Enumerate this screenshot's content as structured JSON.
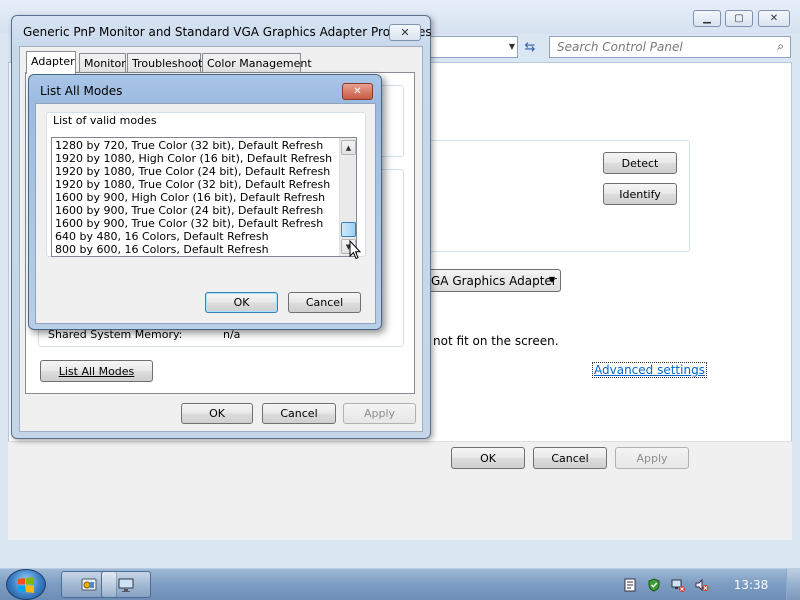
{
  "control_panel": {
    "search_placeholder": "Search Control Panel",
    "detect_label": "Detect",
    "identify_label": "Identify",
    "display_select": "GA Graphics Adapter",
    "fit_text": "not fit on the screen.",
    "advanced_link": "Advanced settings",
    "ok_label": "OK",
    "cancel_label": "Cancel",
    "apply_label": "Apply",
    "minimize_icon": "minimize-icon",
    "maximize_icon": "maximize-icon",
    "close_icon": "close-icon"
  },
  "properties_dialog": {
    "title": "Generic PnP Monitor and Standard VGA Graphics Adapter Properties",
    "close_glyph": "✕",
    "tabs": [
      "Adapter",
      "Monitor",
      "Troubleshoot",
      "Color Management"
    ],
    "active_tab": "Adapter",
    "shared_memory_label": "Shared System Memory:",
    "shared_memory_value": "n/a",
    "list_all_modes_label": "List All Modes",
    "ok_label": "OK",
    "cancel_label": "Cancel",
    "apply_label": "Apply"
  },
  "list_all_modes_dialog": {
    "title": "List All Modes",
    "group_label": "List of valid modes",
    "modes": [
      "1280 by 720, True Color (32 bit), Default Refresh",
      "1920 by 1080, High Color (16 bit), Default Refresh",
      "1920 by 1080, True Color (24 bit), Default Refresh",
      "1920 by 1080, True Color (32 bit), Default Refresh",
      "1600 by 900, High Color (16 bit), Default Refresh",
      "1600 by 900, True Color (24 bit), Default Refresh",
      "1600 by 900, True Color (32 bit), Default Refresh",
      "640 by 480, 16 Colors, Default Refresh",
      "800 by 600, 16 Colors, Default Refresh"
    ],
    "ok_label": "OK",
    "cancel_label": "Cancel"
  },
  "taskbar": {
    "clock": "13:38",
    "start_icon": "windows-logo-icon",
    "tray_icons": [
      "action-center-icon",
      "security-shield-icon",
      "network-icon",
      "volume-muted-icon"
    ]
  },
  "colors": {
    "accent_blue": "#3c7fb1",
    "link_blue": "#0066cc",
    "close_red": "#c75a45",
    "taskbar_blue": "#7e9ec3"
  }
}
